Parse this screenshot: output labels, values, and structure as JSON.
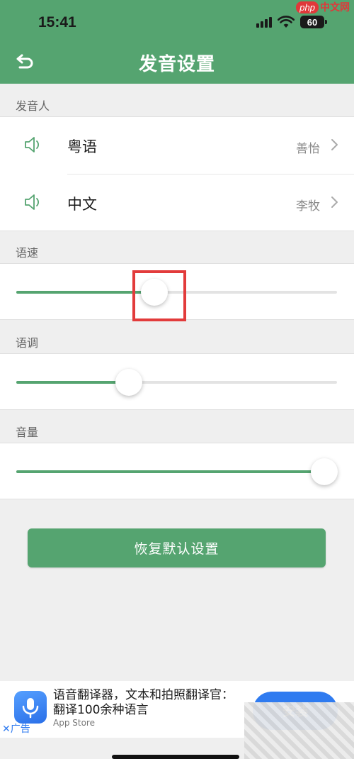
{
  "status_bar": {
    "time": "15:41",
    "battery": "60"
  },
  "watermark": {
    "logo": "php",
    "text": "中文网"
  },
  "header": {
    "title": "发音设置",
    "back_icon": "back-arrow-icon"
  },
  "voice_section": {
    "label": "发音人",
    "items": [
      {
        "language": "粤语",
        "voice": "善怡",
        "icon": "speaker-icon"
      },
      {
        "language": "中文",
        "voice": "李牧",
        "icon": "speaker-icon"
      }
    ]
  },
  "sliders": [
    {
      "label": "语速",
      "value_fraction": 0.43
    },
    {
      "label": "语调",
      "value_fraction": 0.35
    },
    {
      "label": "音量",
      "value_fraction": 0.96
    }
  ],
  "reset_button": {
    "label": "恢复默认设置"
  },
  "ad": {
    "title": "语音翻译器，文本和拍照翻译官：翻译100余种语言",
    "store": "App Store",
    "install": "安装",
    "close_label": "广告"
  },
  "colors": {
    "brand": "#55a470",
    "highlight": "#e23b3b",
    "ad_button": "#2f7bf0"
  }
}
